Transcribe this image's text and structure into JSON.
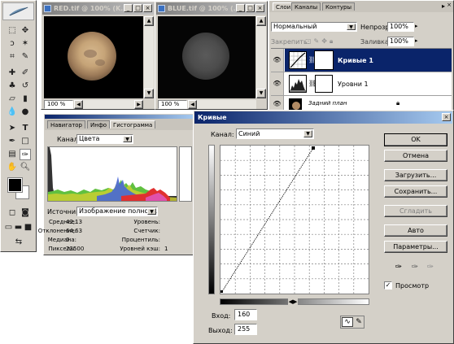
{
  "doc_red": {
    "title": "RED.tif @ 100% (K...",
    "zoom": "100 %"
  },
  "doc_blue": {
    "title": "BLUE.tif @ 100% (...",
    "zoom": "100 %"
  },
  "layers": {
    "tabs": [
      "Слои",
      "Каналы",
      "Контуры"
    ],
    "blend_mode": "Нормальный",
    "opacity_label": "Непрозр.:",
    "opacity_value": "100%",
    "lock_label": "Закрепить:",
    "fill_label": "Заливка:",
    "fill_value": "100%",
    "items": [
      {
        "name": "Кривые 1"
      },
      {
        "name": "Уровни 1"
      },
      {
        "name": "Задний план"
      }
    ]
  },
  "histogram": {
    "tabs": [
      "Навигатор",
      "Инфо",
      "Гистограмма"
    ],
    "channel_label": "Канал:",
    "channel_value": "Цвета",
    "source_label": "Источник:",
    "source_value": "Изображение полнос...",
    "stats": [
      {
        "label": "Среднее:",
        "value": "42,13"
      },
      {
        "label": "Отклонение:",
        "value": "64,63"
      },
      {
        "label": "Медиана:",
        "value": "0"
      },
      {
        "label": "Пикселы:",
        "value": "22500"
      }
    ],
    "stats_right": [
      {
        "label": "Уровень:",
        "value": ""
      },
      {
        "label": "Счетчик:",
        "value": ""
      },
      {
        "label": "Процентиль:",
        "value": ""
      },
      {
        "label": "Уровней кэш:",
        "value": "1"
      }
    ]
  },
  "curves": {
    "title": "Кривые",
    "channel_label": "Канал:",
    "channel_value": "Синий",
    "input_label": "Вход:",
    "input_value": "160",
    "output_label": "Выход:",
    "output_value": "255",
    "buttons": {
      "ok": "OK",
      "cancel": "Отмена",
      "load": "Загрузить...",
      "save": "Сохранить...",
      "smooth": "Сгладить",
      "auto": "Авто",
      "options": "Параметры..."
    },
    "preview_label": "Просмотр",
    "preview_checked": true
  }
}
